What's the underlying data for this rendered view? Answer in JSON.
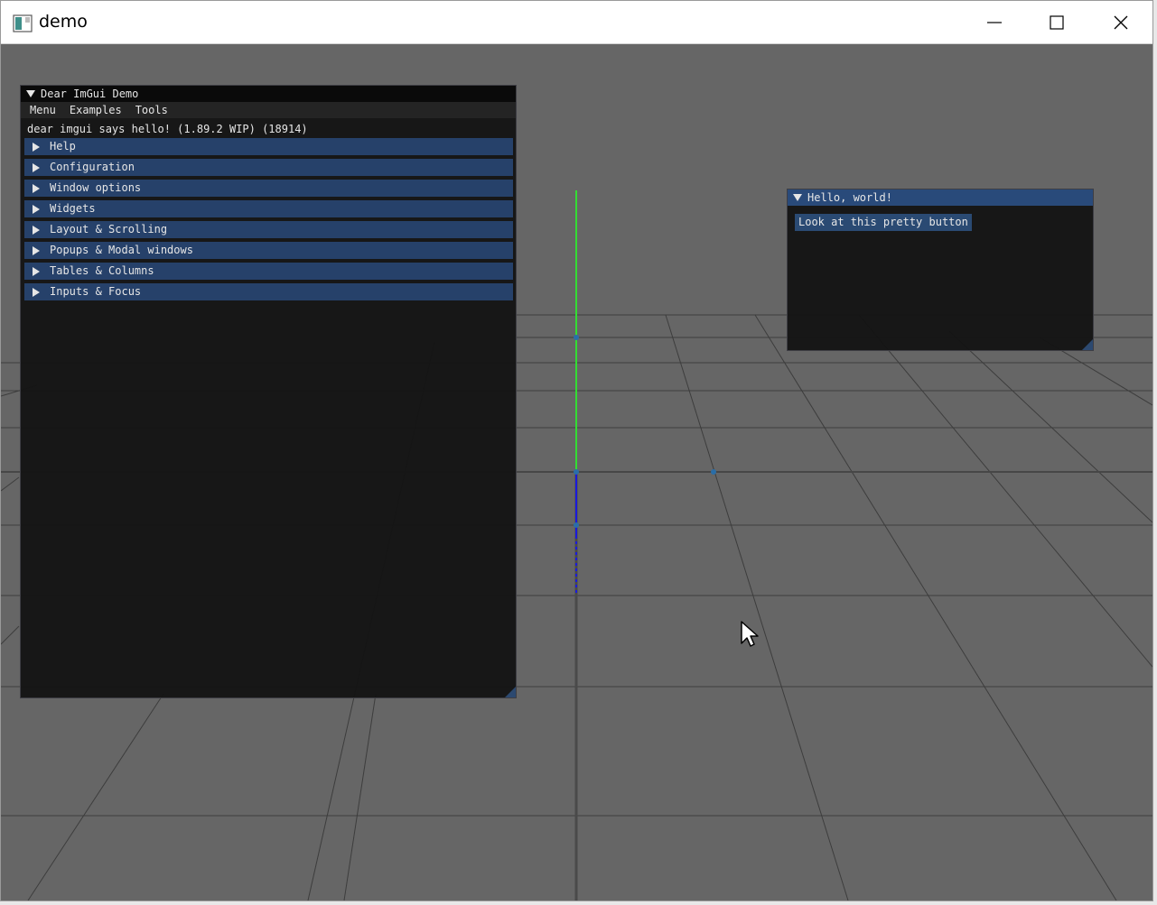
{
  "os_window": {
    "title": "demo",
    "icon": "app-window-icon",
    "controls": [
      "minimize-icon",
      "maximize-icon",
      "close-icon"
    ]
  },
  "demo_window": {
    "title": "Dear ImGui Demo",
    "menu": [
      "Menu",
      "Examples",
      "Tools"
    ],
    "hello_text": "dear imgui says hello! (1.89.2 WIP) (18914)",
    "headers": [
      "Help",
      "Configuration",
      "Window options",
      "Widgets",
      "Layout & Scrolling",
      "Popups & Modal windows",
      "Tables & Columns",
      "Inputs & Focus"
    ]
  },
  "hello_window": {
    "title": "Hello, world!",
    "button_label": "Look at this pretty button"
  },
  "colors": {
    "background": "#666666",
    "header": "#26416a",
    "axis_green": "#33cc33",
    "axis_blue": "#1a1acc",
    "grid": "#3c3c3c"
  }
}
